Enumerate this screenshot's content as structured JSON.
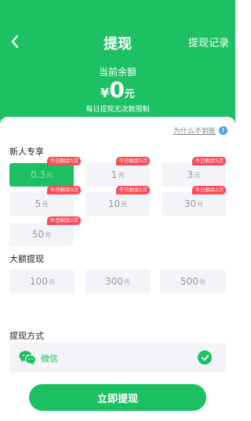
{
  "header": {
    "title": "提现",
    "records_link": "提现记录",
    "balance_label": "当前余额",
    "currency_symbol": "¥",
    "balance_value": "0",
    "balance_unit": "元",
    "daily_note": "每日提现无次数限制"
  },
  "help": {
    "label": "为什么不到账",
    "icon_glyph": "!"
  },
  "sections": {
    "newbie_title": "新人专享",
    "large_title": "大额提现",
    "method_title": "提现方式"
  },
  "unit": "元",
  "newbie_options": [
    {
      "value": "0.3",
      "tag": "今日剩余5次",
      "selected": true
    },
    {
      "value": "1",
      "tag": "今日剩余5次",
      "selected": false
    },
    {
      "value": "3",
      "tag": "今日剩余5次",
      "selected": false
    },
    {
      "value": "5",
      "tag": "今日剩余5次",
      "selected": false
    },
    {
      "value": "10",
      "tag": "今日剩余5次",
      "selected": false
    },
    {
      "value": "30",
      "tag": "今日剩余2次",
      "selected": false
    },
    {
      "value": "50",
      "tag": "今日剩余2次",
      "selected": false
    }
  ],
  "large_options": [
    {
      "value": "100"
    },
    {
      "value": "300"
    },
    {
      "value": "500"
    }
  ],
  "method": {
    "label": "微信",
    "icon": "wechat-icon",
    "selected": true
  },
  "submit_label": "立即提现",
  "colors": {
    "brand_green": "#1dc163",
    "tag_red": "#ff4b57",
    "help_blue": "#4aa3f2"
  }
}
